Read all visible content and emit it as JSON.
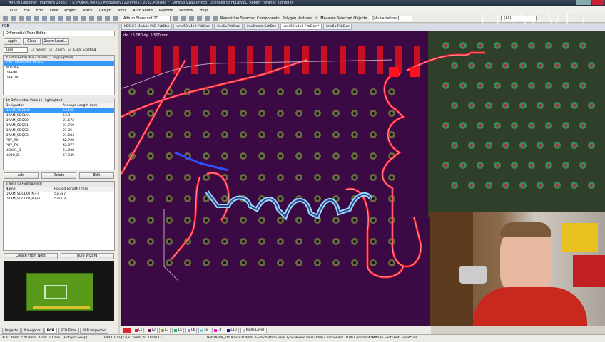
{
  "window": {
    "title": "Altium Designer (Platform 24352) - S:\\VOIPAC\\iMX53 Modules\\v112\\vme53 v1p2.PcbDoc * - vme53 v1p2.PrjPcb. Licensed to FEDEVEL. Robert Feranec signed in"
  },
  "menu": [
    "DXP",
    "File",
    "Edit",
    "View",
    "Project",
    "Place",
    "Design",
    "Tools",
    "Auto Route",
    "Reports",
    "Window",
    "Help"
  ],
  "toolbar": {
    "view_mode": "Altium Standard 2D",
    "reposition": "Reposition Selected Components",
    "polygon": "Polygon Vertices",
    "measure": "Measure Selected Objects",
    "variations": "[No Variations]",
    "filter": "(All)"
  },
  "doc_tabs": [
    "KDS G7 Module PCB.PcbDoc",
    "vme53 v1p2.PcbDoc",
    "imx6b.PcbDoc",
    "imx6mnet.SchDoc",
    "vme53 v1p2.PcbDoc *",
    "imx6b.PcbDoc"
  ],
  "watermark": "FEDEVEL",
  "panel": {
    "title": "PCB",
    "mode": "Differential Pairs Editor",
    "buttons": {
      "apply": "Apply",
      "clear": "Clear",
      "zoom_level": "Zoom Level..."
    },
    "dim": "Dim",
    "select": "Select",
    "zoom": "Zoom",
    "clear_existing": "Clear Existing",
    "classes_header": "4 Differential Pair Classes (1 Highlighted)",
    "classes": [
      "<All Differential Pairs>",
      "ALLDIFF",
      "DIFF90",
      "DIFF100"
    ],
    "pairs_header": "10 Differential Pairs (1 Highlighted)",
    "pairs_cols": [
      "Designator",
      "Average Length (mm)"
    ],
    "pairs": [
      [
        "DRAM_SDCLK0",
        "53.195"
      ],
      [
        "DRAM_SDCLK1",
        "53.3"
      ],
      [
        "DRAM_SDQS0",
        "21.573"
      ],
      [
        "DRAM_SDQS1",
        "21.769"
      ],
      [
        "DRAM_SDQS2",
        "21.35"
      ],
      [
        "DRAM_SDQS3",
        "21.684"
      ],
      [
        "PHY_RX",
        "42.700"
      ],
      [
        "PHY_TX",
        "42.877"
      ],
      [
        "USBH1_D",
        "54.000"
      ],
      [
        "USBO_D",
        "57.939"
      ]
    ],
    "pair_buttons": {
      "add": "Add",
      "delete": "Delete",
      "edit": "Edit"
    },
    "nets_header": "2 Nets (0 Highlighted)",
    "nets_cols": [
      "Name",
      "Routed Length (mm)"
    ],
    "nets": [
      [
        "DRAM_SDCLK0_N (-)",
        "53.387"
      ],
      [
        "DRAM_SDCLK0_P (+)",
        "53.003"
      ]
    ],
    "bottom_buttons": {
      "create": "Create From Nets",
      "wizard": "Rule Wizard"
    },
    "tabs": [
      "Projects",
      "Navigator",
      "PCB",
      "PCB Filter",
      "PCB Inspector"
    ],
    "active_tab": "PCB"
  },
  "canvas": {
    "readout": "dx: 16.180  dy: 5.500 mm"
  },
  "layers": [
    {
      "name": "L1",
      "color": "#e0202a"
    },
    {
      "name": "L2",
      "color": "#7a1f5a"
    },
    {
      "name": "L3",
      "color": "#b0a020"
    },
    {
      "name": "L5",
      "color": "#20b070"
    },
    {
      "name": "L6",
      "color": "#8a80d0"
    },
    {
      "name": "L8",
      "color": "#80d0e0"
    },
    {
      "name": "L9",
      "color": "#e020c0"
    },
    {
      "name": "L10",
      "color": "#1010a0"
    },
    {
      "name": "Multi-Layer",
      "color": "#c0c0c0"
    }
  ],
  "status": {
    "coords": "X:32.4mm Y:28.0mm",
    "grid": "Grid: 0.1mm",
    "snap": "(Hotspot Snap)",
    "pad": "Pad U100-J23(32.5mm,20.1mm) L1",
    "net": "Net DRAM_D4 X-Size:0.4mm Y-Size:0.4mm Hole Type:Round Hole:0mm   Component U100 Comment:IMX536 Footprint: FBGA529"
  }
}
